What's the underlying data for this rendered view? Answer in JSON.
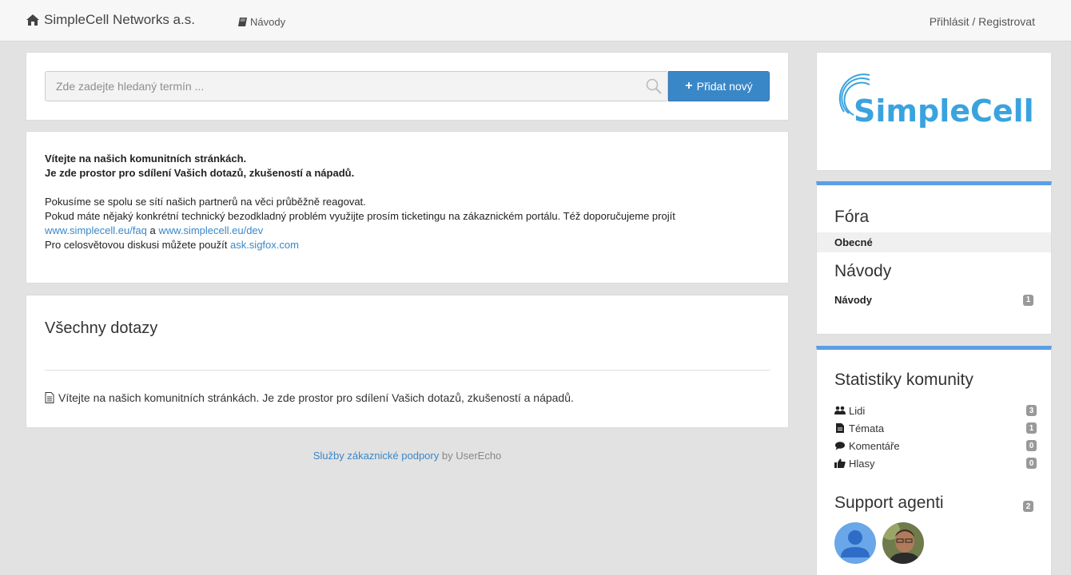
{
  "header": {
    "brand": "SimpleCell Networks a.s.",
    "guides_link": "Návody",
    "login_link": "Přihlásit / Registrovat"
  },
  "search": {
    "placeholder": "Zde zadejte hledaný termín ...",
    "add_button": "Přidat nový"
  },
  "welcome": {
    "line1": "Vítejte na našich komunitních stránkách.",
    "line2": "Je zde prostor pro sdílení Vašich dotazů, zkušeností a nápadů.",
    "p1": "Pokusíme se spolu se sítí našich partnerů na věci průběžně reagovat.",
    "p2": "Pokud máte nějaký konkrétní technický bezodkladný problém využijte prosím ticketingu na zákaznickém portálu. Též doporučujeme projít",
    "link_faq": "www.simplecell.eu/faq",
    "and": "a",
    "link_dev": "www.simplecell.eu/dev",
    "p3": "Pro celosvětovou diskusi můžete použít",
    "link_sigfox": "ask.sigfox.com"
  },
  "questions": {
    "title": "Všechny dotazy",
    "items": [
      {
        "text": "Vítejte na našich komunitních stránkách. Je zde prostor pro sdílení Vašich dotazů, zkušeností a nápadů."
      }
    ]
  },
  "footer": {
    "link": "Služby zákaznické podpory",
    "suffix": "by UserEcho"
  },
  "sidebar": {
    "logo_text": "SimpleCell",
    "forums_title": "Fóra",
    "forum_general": "Obecné",
    "guides_title": "Návody",
    "guides_item": "Návody",
    "guides_count": "1",
    "stats_title": "Statistiky komunity",
    "stats": [
      {
        "label": "Lidi",
        "count": "3",
        "icon": "users-icon"
      },
      {
        "label": "Témata",
        "count": "1",
        "icon": "file-icon"
      },
      {
        "label": "Komentáře",
        "count": "0",
        "icon": "comments-icon"
      },
      {
        "label": "Hlasy",
        "count": "0",
        "icon": "thumbs-up-icon"
      }
    ],
    "agents_title": "Support agenti",
    "agents_count": "2"
  },
  "colors": {
    "accent": "#3a87c8",
    "sidebar_rule": "#5b9ee6",
    "logo": "#3aa3df"
  }
}
